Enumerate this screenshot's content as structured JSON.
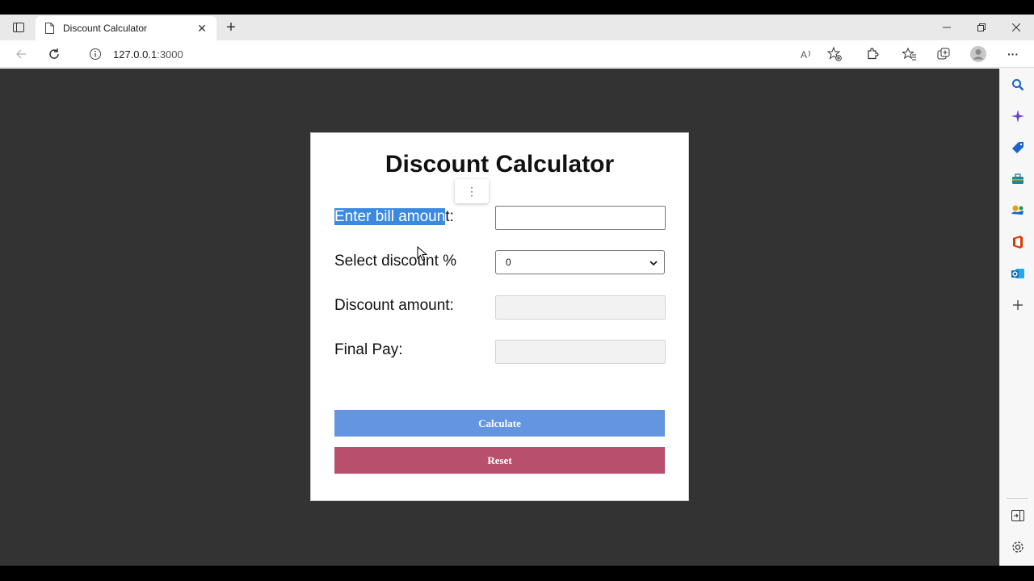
{
  "browser": {
    "tab_title": "Discount Calculator",
    "url_host": "127.0.0.1",
    "url_port": ":3000",
    "new_tab_symbol": "+",
    "close_tab_symbol": "✕",
    "more_symbol": "···"
  },
  "page": {
    "title": "Discount Calculator",
    "bill_label_selected": "Enter bill amoun",
    "bill_label_rest": "t:",
    "bill_value": "",
    "discount_label": "Select discount %",
    "discount_selected": "0",
    "discount_amount_label": "Discount amount:",
    "discount_amount_value": "",
    "final_pay_label": "Final Pay:",
    "final_pay_value": "",
    "calculate_label": "Calculate",
    "reset_label": "Reset",
    "mini_menu_symbol": "⋮"
  },
  "colors": {
    "background": "#333333",
    "calculate_button": "#6495e0",
    "reset_button": "#b8506d",
    "selection": "#3b8ae0"
  },
  "sidebar_icons": [
    "search-icon",
    "copilot-icon",
    "shopping-icon",
    "tools-icon",
    "games-icon",
    "office-icon",
    "outlook-icon",
    "add-icon",
    "split-screen-icon",
    "settings-icon"
  ]
}
